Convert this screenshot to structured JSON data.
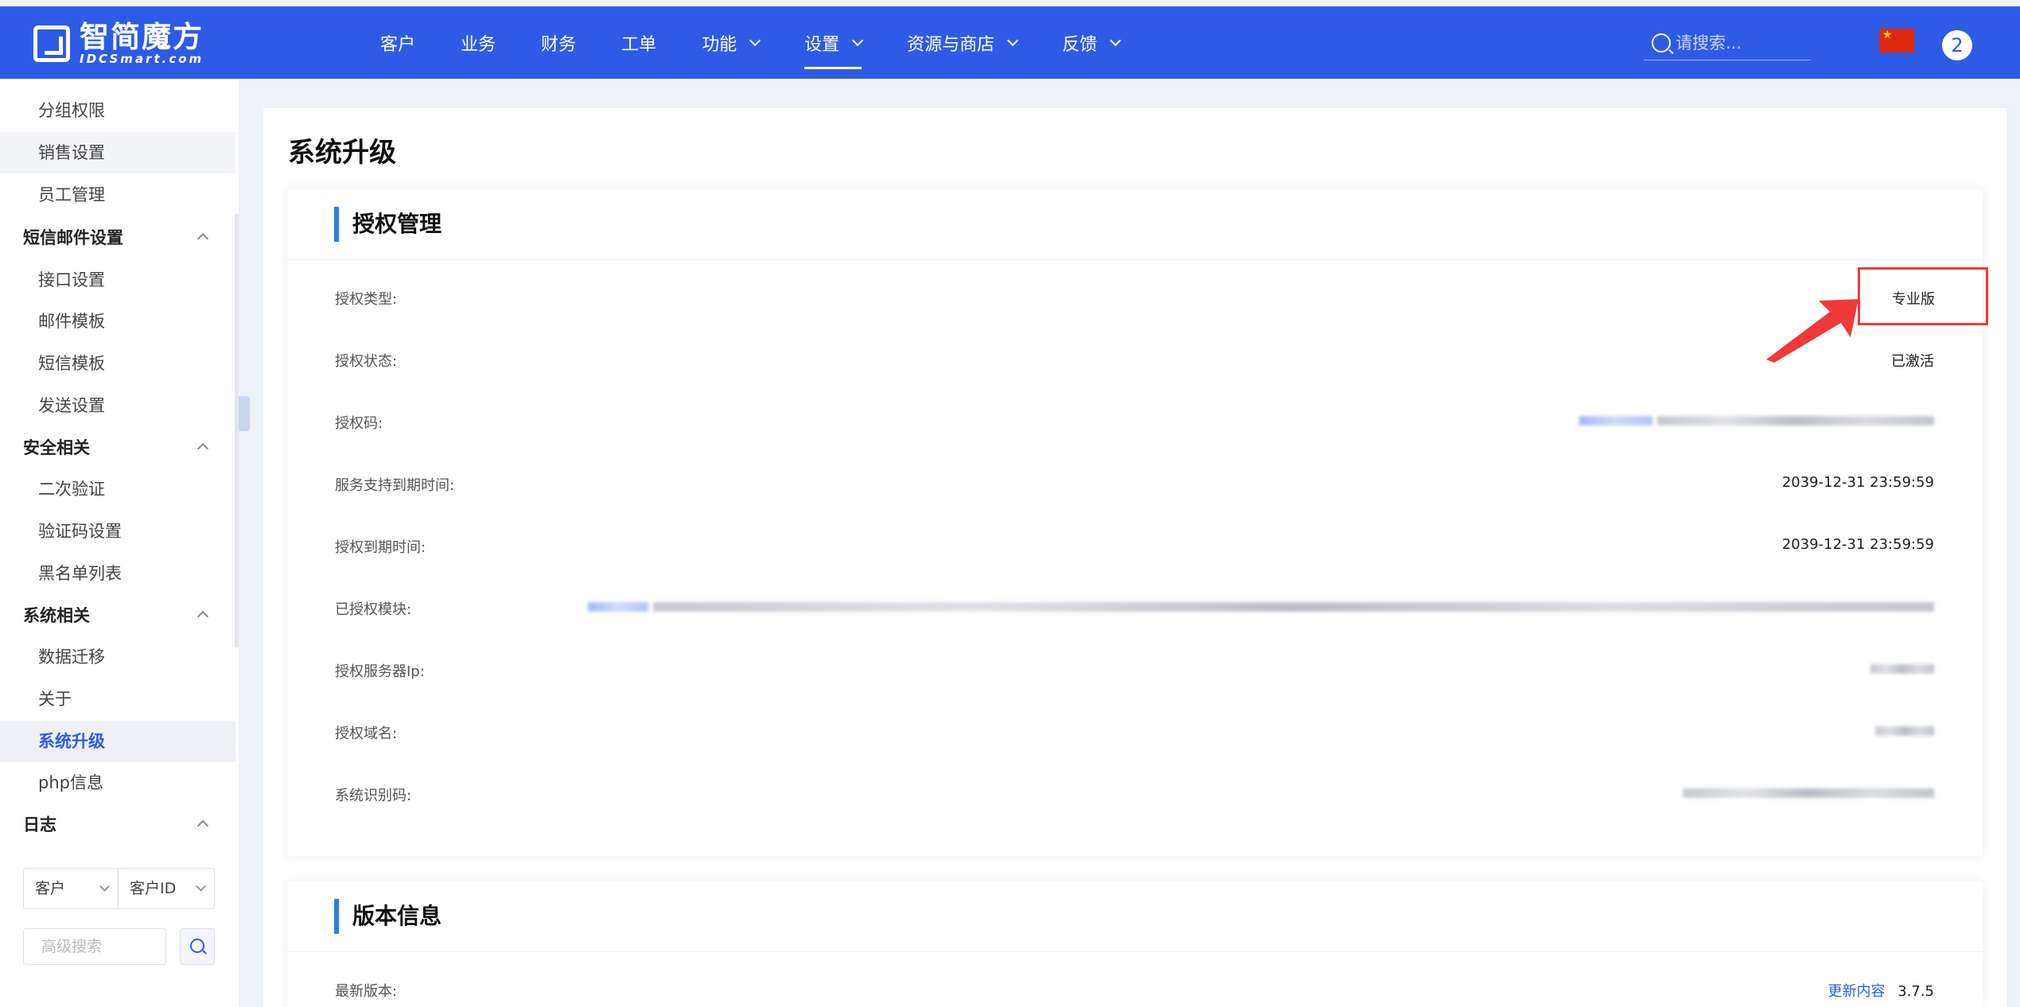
{
  "header": {
    "logo_cn": "智简魔方",
    "logo_en": "IDCSmart.com",
    "nav": [
      {
        "label": "客户"
      },
      {
        "label": "业务"
      },
      {
        "label": "财务"
      },
      {
        "label": "工单"
      },
      {
        "label": "功能",
        "dropdown": true
      },
      {
        "label": "设置",
        "dropdown": true,
        "active": true
      },
      {
        "label": "资源与商店",
        "dropdown": true
      },
      {
        "label": "反馈",
        "dropdown": true
      }
    ],
    "search_placeholder": "请搜索...",
    "notification_count": "2",
    "flag_icon": "china-flag-icon"
  },
  "sidebar": {
    "items": [
      {
        "type": "item",
        "label": "分组权限"
      },
      {
        "type": "item",
        "label": "销售设置",
        "hover": true
      },
      {
        "type": "item",
        "label": "员工管理"
      },
      {
        "type": "group",
        "label": "短信邮件设置"
      },
      {
        "type": "item",
        "label": "接口设置"
      },
      {
        "type": "item",
        "label": "邮件模板"
      },
      {
        "type": "item",
        "label": "短信模板"
      },
      {
        "type": "item",
        "label": "发送设置"
      },
      {
        "type": "group",
        "label": "安全相关"
      },
      {
        "type": "item",
        "label": "二次验证"
      },
      {
        "type": "item",
        "label": "验证码设置"
      },
      {
        "type": "item",
        "label": "黑名单列表"
      },
      {
        "type": "group",
        "label": "系统相关"
      },
      {
        "type": "item",
        "label": "数据迁移"
      },
      {
        "type": "item",
        "label": "关于"
      },
      {
        "type": "item",
        "label": "系统升级",
        "active": true
      },
      {
        "type": "item",
        "label": "php信息"
      },
      {
        "type": "group",
        "label": "日志"
      }
    ],
    "filter_type": "客户",
    "filter_field": "客户ID",
    "adv_search_placeholder": "高级搜索"
  },
  "page": {
    "title": "系统升级",
    "license": {
      "heading": "授权管理",
      "rows": [
        {
          "label": "授权类型:",
          "value": "专业版"
        },
        {
          "label": "授权状态:",
          "value": "已激活"
        },
        {
          "label": "授权码:",
          "value": ""
        },
        {
          "label": "服务支持到期时间:",
          "value": "2039-12-31 23:59:59"
        },
        {
          "label": "授权到期时间:",
          "value": "2039-12-31 23:59:59"
        },
        {
          "label": "已授权模块:",
          "value": ""
        },
        {
          "label": "授权服务器Ip:",
          "value": ""
        },
        {
          "label": "授权域名:",
          "value": ""
        },
        {
          "label": "系统识别码:",
          "value": ""
        }
      ]
    },
    "version": {
      "heading": "版本信息",
      "latest_label": "最新版本:",
      "update_link": "更新内容",
      "latest_value": "3.7.5"
    }
  },
  "colors": {
    "brand": "#2e5be6",
    "section_accent": "#2e7de6",
    "annotation": "#f03a3a"
  }
}
